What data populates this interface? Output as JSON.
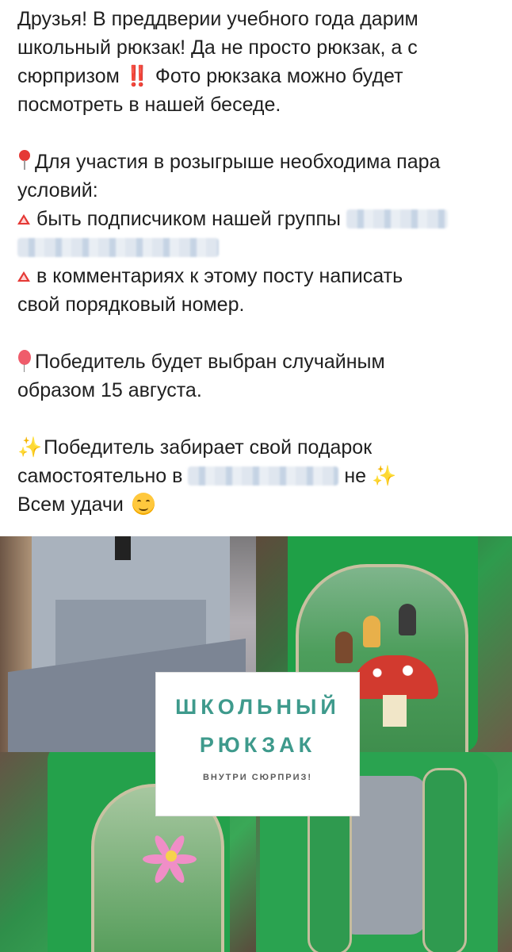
{
  "post": {
    "p1": [
      "Друзья! В преддверии учебного года дарим",
      "школьный рюкзак! Да не просто рюкзак, а с",
      "сюрпризом",
      " Фото рюкзака можно будет",
      "посмотреть в нашей беседе."
    ],
    "p1_emoji": "‼️",
    "p2_line1": "Для участия в розыгрыше необходима пара",
    "p2_line2": "условий:",
    "p2_cond1": "быть подписчиком нашей группы",
    "p2_cond2_a": "в комментариях к этому посту написать",
    "p2_cond2_b": "свой порядковый номер.",
    "p3_line1": "Победитель будет выбран случайным",
    "p3_line2": "образом 15 августа.",
    "p4_line1": "Победитель забирает свой подарок",
    "p4_line2a": "самостоятельно в",
    "p4_line2b": "не",
    "p4_line3": "Всем удачи",
    "sparkles": "✨"
  },
  "image_card": {
    "line1": "ШКОЛЬНЫЙ",
    "line2": "РЮКЗАК",
    "line3": "ВНУТРИ СЮРПРИЗ!"
  },
  "colors": {
    "card_title": "#3e9a8c",
    "backpack_green": "#1fa047"
  }
}
